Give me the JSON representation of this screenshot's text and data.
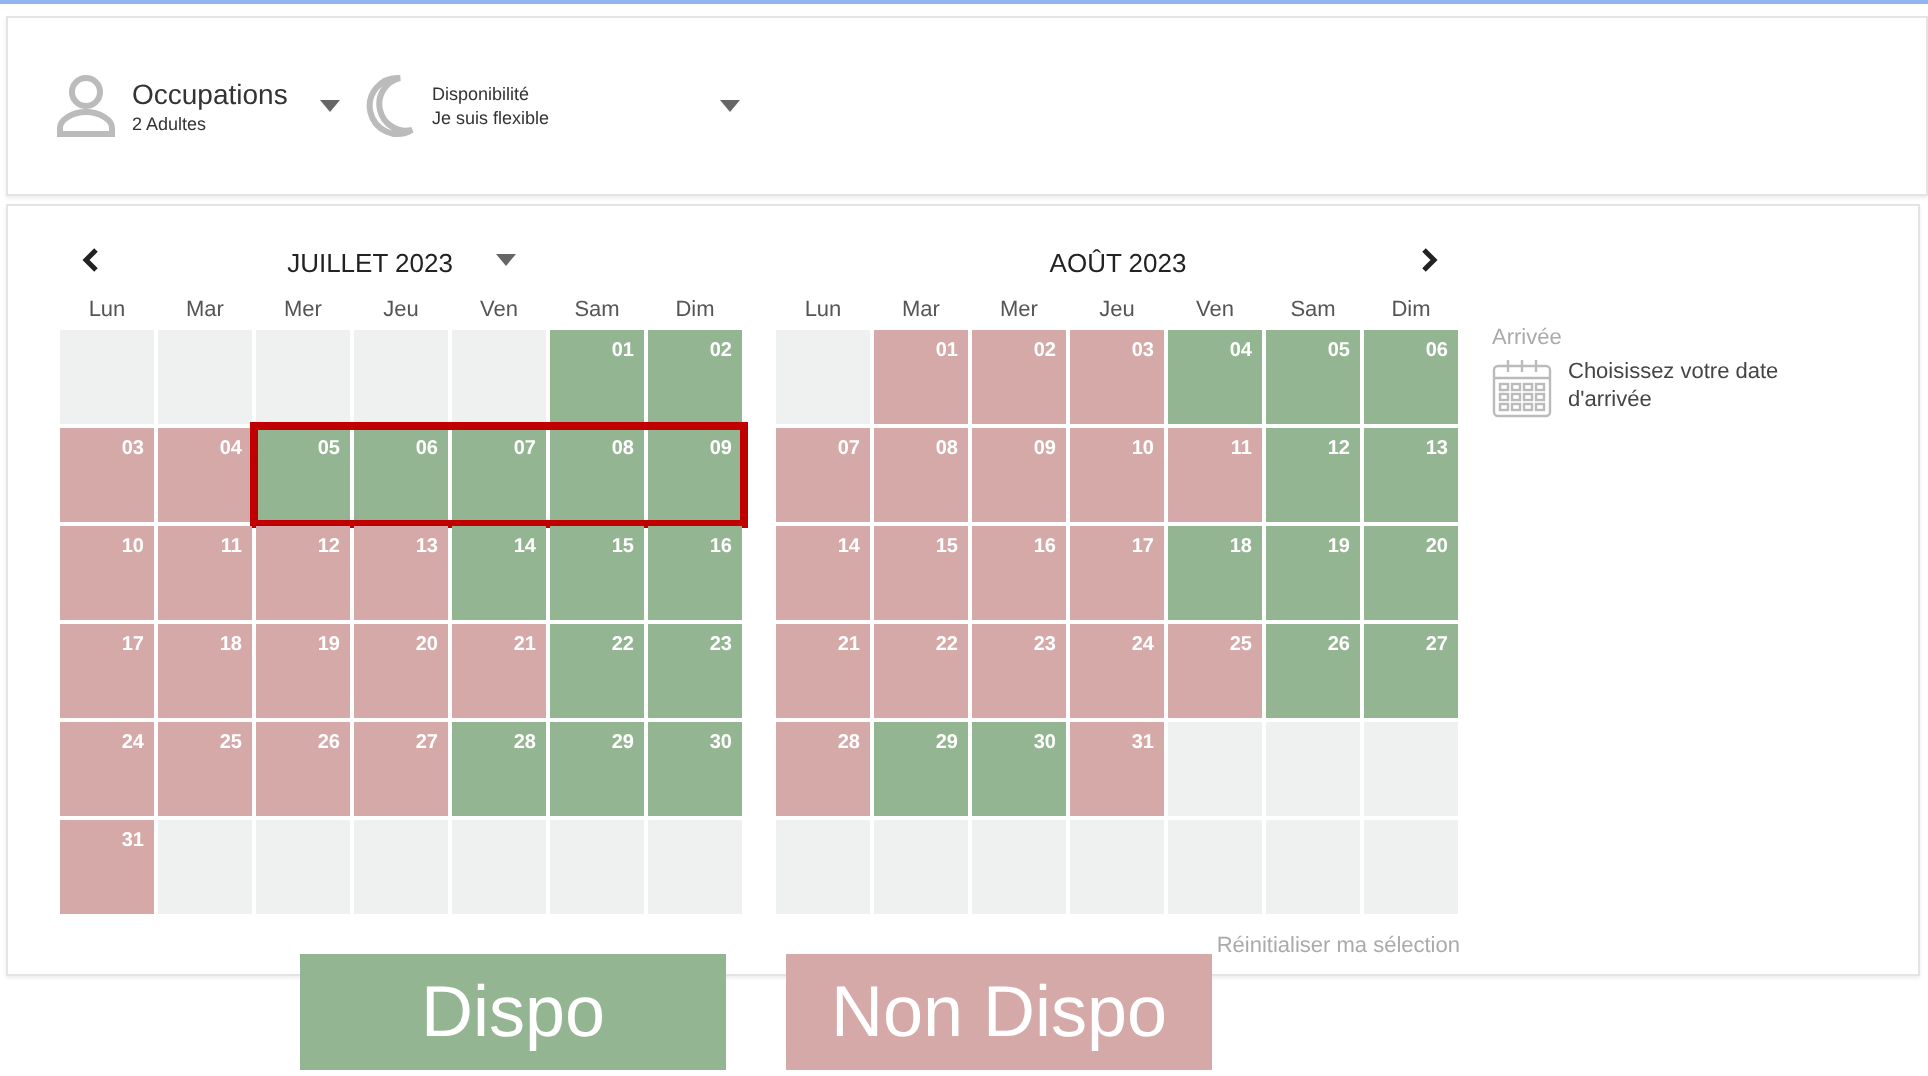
{
  "filters": [
    {
      "kind": "person",
      "label": "Occupations",
      "value": "2 Adultes"
    },
    {
      "kind": "moon",
      "label": "Disponibilité",
      "value": "Je suis flexible"
    }
  ],
  "months": [
    {
      "title": "JUILLET 2023",
      "has_prev": true,
      "has_next": false,
      "has_dropdown": true,
      "weekdays": [
        "Lun",
        "Mar",
        "Mer",
        "Jeu",
        "Ven",
        "Sam",
        "Dim"
      ],
      "weeks": [
        [
          {
            "kind": "empty",
            "framed": false
          },
          {
            "kind": "empty",
            "framed": false
          },
          {
            "kind": "empty",
            "framed": false
          },
          {
            "kind": "empty",
            "framed": false
          },
          {
            "kind": "empty",
            "framed": false
          },
          {
            "day": "01",
            "kind": "available",
            "framed": false
          },
          {
            "day": "02",
            "kind": "available",
            "framed": false
          }
        ],
        [
          {
            "day": "03",
            "kind": "unavailable",
            "framed": false
          },
          {
            "day": "04",
            "kind": "unavailable",
            "framed": false
          },
          {
            "day": "05",
            "kind": "available",
            "framed": true
          },
          {
            "day": "06",
            "kind": "available",
            "framed": true
          },
          {
            "day": "07",
            "kind": "available",
            "framed": true
          },
          {
            "day": "08",
            "kind": "available",
            "framed": true
          },
          {
            "day": "09",
            "kind": "available",
            "framed": true
          }
        ],
        [
          {
            "day": "10",
            "kind": "unavailable",
            "framed": false
          },
          {
            "day": "11",
            "kind": "unavailable",
            "framed": false
          },
          {
            "day": "12",
            "kind": "unavailable",
            "framed": false
          },
          {
            "day": "13",
            "kind": "unavailable",
            "framed": false
          },
          {
            "day": "14",
            "kind": "available",
            "framed": false
          },
          {
            "day": "15",
            "kind": "available",
            "framed": false
          },
          {
            "day": "16",
            "kind": "available",
            "framed": false
          }
        ],
        [
          {
            "day": "17",
            "kind": "unavailable",
            "framed": false
          },
          {
            "day": "18",
            "kind": "unavailable",
            "framed": false
          },
          {
            "day": "19",
            "kind": "unavailable",
            "framed": false
          },
          {
            "day": "20",
            "kind": "unavailable",
            "framed": false
          },
          {
            "day": "21",
            "kind": "unavailable",
            "framed": false
          },
          {
            "day": "22",
            "kind": "available",
            "framed": false
          },
          {
            "day": "23",
            "kind": "available",
            "framed": false
          }
        ],
        [
          {
            "day": "24",
            "kind": "unavailable",
            "framed": false
          },
          {
            "day": "25",
            "kind": "unavailable",
            "framed": false
          },
          {
            "day": "26",
            "kind": "unavailable",
            "framed": false
          },
          {
            "day": "27",
            "kind": "unavailable",
            "framed": false
          },
          {
            "day": "28",
            "kind": "available",
            "framed": false
          },
          {
            "day": "29",
            "kind": "available",
            "framed": false
          },
          {
            "day": "30",
            "kind": "available",
            "framed": false
          }
        ],
        [
          {
            "day": "31",
            "kind": "unavailable",
            "framed": false
          },
          {
            "kind": "empty",
            "framed": false
          },
          {
            "kind": "empty",
            "framed": false
          },
          {
            "kind": "empty",
            "framed": false
          },
          {
            "kind": "empty",
            "framed": false
          },
          {
            "kind": "empty",
            "framed": false
          },
          {
            "kind": "empty",
            "framed": false
          }
        ]
      ]
    },
    {
      "title": "AOÛT 2023",
      "has_prev": false,
      "has_next": true,
      "has_dropdown": false,
      "weekdays": [
        "Lun",
        "Mar",
        "Mer",
        "Jeu",
        "Ven",
        "Sam",
        "Dim"
      ],
      "weeks": [
        [
          {
            "kind": "empty",
            "framed": false
          },
          {
            "day": "01",
            "kind": "unavailable",
            "framed": false
          },
          {
            "day": "02",
            "kind": "unavailable",
            "framed": false
          },
          {
            "day": "03",
            "kind": "unavailable",
            "framed": false
          },
          {
            "day": "04",
            "kind": "available",
            "framed": false
          },
          {
            "day": "05",
            "kind": "available",
            "framed": false
          },
          {
            "day": "06",
            "kind": "available",
            "framed": false
          }
        ],
        [
          {
            "day": "07",
            "kind": "unavailable",
            "framed": false
          },
          {
            "day": "08",
            "kind": "unavailable",
            "framed": false
          },
          {
            "day": "09",
            "kind": "unavailable",
            "framed": false
          },
          {
            "day": "10",
            "kind": "unavailable",
            "framed": false
          },
          {
            "day": "11",
            "kind": "unavailable",
            "framed": false
          },
          {
            "day": "12",
            "kind": "available",
            "framed": false
          },
          {
            "day": "13",
            "kind": "available",
            "framed": false
          }
        ],
        [
          {
            "day": "14",
            "kind": "unavailable",
            "framed": false
          },
          {
            "day": "15",
            "kind": "unavailable",
            "framed": false
          },
          {
            "day": "16",
            "kind": "unavailable",
            "framed": false
          },
          {
            "day": "17",
            "kind": "unavailable",
            "framed": false
          },
          {
            "day": "18",
            "kind": "available",
            "framed": false
          },
          {
            "day": "19",
            "kind": "available",
            "framed": false
          },
          {
            "day": "20",
            "kind": "available",
            "framed": false
          }
        ],
        [
          {
            "day": "21",
            "kind": "unavailable",
            "framed": false
          },
          {
            "day": "22",
            "kind": "unavailable",
            "framed": false
          },
          {
            "day": "23",
            "kind": "unavailable",
            "framed": false
          },
          {
            "day": "24",
            "kind": "unavailable",
            "framed": false
          },
          {
            "day": "25",
            "kind": "unavailable",
            "framed": false
          },
          {
            "day": "26",
            "kind": "available",
            "framed": false
          },
          {
            "day": "27",
            "kind": "available",
            "framed": false
          }
        ],
        [
          {
            "day": "28",
            "kind": "unavailable",
            "framed": false
          },
          {
            "day": "29",
            "kind": "available",
            "framed": false
          },
          {
            "day": "30",
            "kind": "available",
            "framed": false
          },
          {
            "day": "31",
            "kind": "unavailable",
            "framed": false
          },
          {
            "kind": "empty",
            "framed": false
          },
          {
            "kind": "empty",
            "framed": false
          },
          {
            "kind": "empty",
            "framed": false
          }
        ],
        [
          {
            "kind": "empty",
            "framed": false
          },
          {
            "kind": "empty",
            "framed": false
          },
          {
            "kind": "empty",
            "framed": false
          },
          {
            "kind": "empty",
            "framed": false
          },
          {
            "kind": "empty",
            "framed": false
          },
          {
            "kind": "empty",
            "framed": false
          },
          {
            "kind": "empty",
            "framed": false
          }
        ]
      ]
    }
  ],
  "reset_link": "Réinitialiser ma sélection",
  "arrival": {
    "label": "Arrivée",
    "prompt": "Choisissez votre date d'arrivée"
  },
  "legend": [
    {
      "label": "Dispo",
      "kind": "available"
    },
    {
      "label": "Non Dispo",
      "kind": "unavailable"
    }
  ]
}
